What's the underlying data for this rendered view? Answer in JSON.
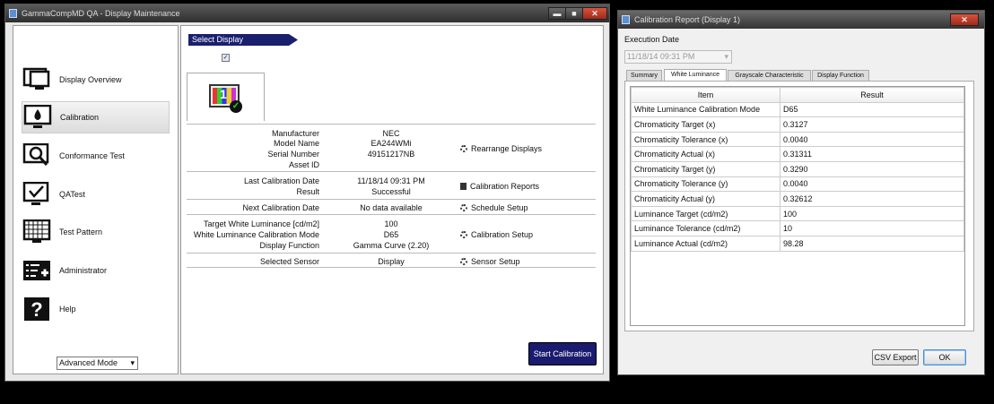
{
  "main_window": {
    "title": "GammaCompMD QA - Display Maintenance",
    "min_symbol": "▬",
    "max_symbol": "■",
    "close_symbol": "✕"
  },
  "nav": {
    "items": [
      {
        "label": "Display Overview",
        "icon": "display-overview-icon"
      },
      {
        "label": "Calibration",
        "icon": "calibration-icon"
      },
      {
        "label": "Conformance Test",
        "icon": "conformance-test-icon"
      },
      {
        "label": "QATest",
        "icon": "qatest-icon"
      },
      {
        "label": "Test Pattern",
        "icon": "test-pattern-icon"
      },
      {
        "label": "Administrator",
        "icon": "administrator-icon"
      },
      {
        "label": "Help",
        "icon": "help-icon"
      }
    ],
    "mode_select": "Advanced Mode",
    "dropdown_arrow": "▾"
  },
  "display": {
    "select_header": "Select Display",
    "checkbox_mark": "✓",
    "display_number": "1",
    "check_glyph": "✓"
  },
  "info": {
    "manufacturer_label": "Manufacturer",
    "manufacturer": "NEC",
    "model_label": "Model Name",
    "model": "EA244WMi",
    "serial_label": "Serial Number",
    "serial": "49151217NB",
    "asset_label": "Asset ID",
    "asset": "",
    "rearrange": "Rearrange Displays",
    "last_cal_label": "Last Calibration Date",
    "last_cal": "11/18/14 09:31 PM",
    "result_label": "Result",
    "result": "Successful",
    "cal_reports": "Calibration Reports",
    "next_cal_label": "Next Calibration Date",
    "next_cal": "No data available",
    "schedule": "Schedule Setup",
    "target_lum_label": "Target White Luminance [cd/m2]",
    "target_lum": "100",
    "wl_mode_label": "White Luminance Calibration Mode",
    "wl_mode": "D65",
    "disp_func_label": "Display Function",
    "disp_func": "Gamma Curve (2.20)",
    "cal_setup": "Calibration Setup",
    "sensor_label": "Selected Sensor",
    "sensor": "Display",
    "sensor_setup": "Sensor Setup"
  },
  "start_button": "Start Calibration",
  "report_window": {
    "title": "Calibration Report (Display 1)",
    "close_symbol": "✕",
    "exec_label": "Execution Date",
    "exec_value": "11/18/14 09:31 PM",
    "tabs": [
      "Summary",
      "White Luminance",
      "Grayscale Characteristic",
      "Display Function"
    ],
    "active_tab": 1,
    "table_headers": [
      "Item",
      "Result"
    ],
    "rows": [
      [
        "White Luminance Calibration Mode",
        "D65"
      ],
      [
        "Chromaticity Target (x)",
        "0.3127"
      ],
      [
        "Chromaticity Tolerance (x)",
        "0.0040"
      ],
      [
        "Chromaticity Actual (x)",
        "0.31311"
      ],
      [
        "Chromaticity Target (y)",
        "0.3290"
      ],
      [
        "Chromaticity Tolerance (y)",
        "0.0040"
      ],
      [
        "Chromaticity Actual (y)",
        "0.32612"
      ],
      [
        "Luminance Target (cd/m2)",
        "100"
      ],
      [
        "Luminance Tolerance (cd/m2)",
        "10"
      ],
      [
        "Luminance Actual (cd/m2)",
        "98.28"
      ]
    ],
    "csv_export": "CSV Export",
    "ok": "OK"
  }
}
